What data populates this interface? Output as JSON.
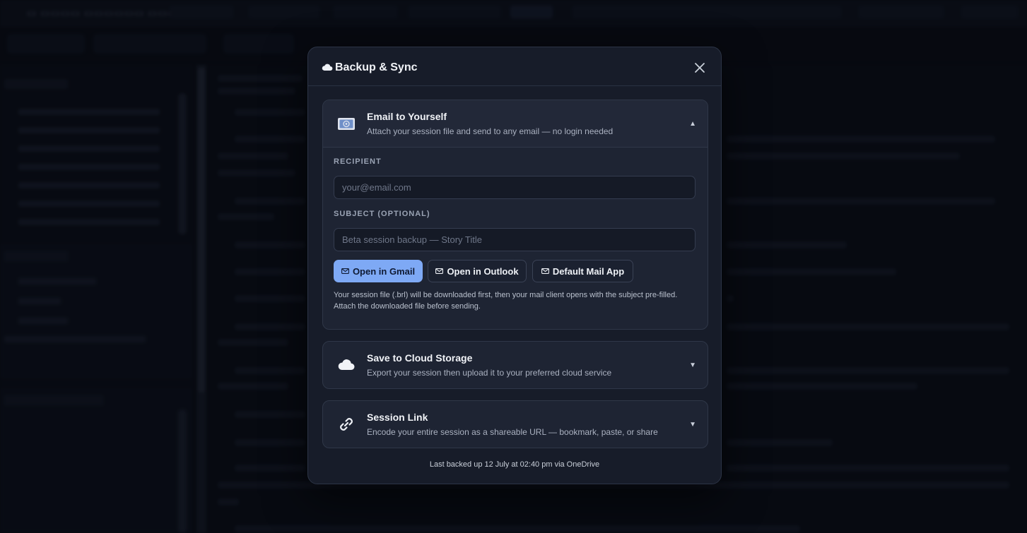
{
  "modal": {
    "title": "Backup & Sync",
    "close_icon": "close-icon",
    "email_section": {
      "title": "Email to Yourself",
      "subtitle": "Attach your session file and send to any email — no login needed",
      "recipient_label": "RECIPIENT",
      "recipient_placeholder": "your@email.com",
      "subject_label": "SUBJECT (OPTIONAL)",
      "subject_placeholder": "Beta session backup — Story Title",
      "buttons": {
        "gmail": "Open in Gmail",
        "outlook": "Open in Outlook",
        "default_mail": "Default Mail App"
      },
      "hint": "Your session file (.brl) will be downloaded first, then your mail client opens with the subject pre-filled. Attach the downloaded file before sending.",
      "expanded": true
    },
    "cloud_section": {
      "title": "Save to Cloud Storage",
      "subtitle": "Export your session then upload it to your preferred cloud service",
      "expanded": false
    },
    "link_section": {
      "title": "Session Link",
      "subtitle": "Encode your entire session as a shareable URL — bookmark, paste, or share",
      "expanded": false
    },
    "footer": "Last backed up 12 July at 02:40 pm via OneDrive"
  },
  "colors": {
    "accent": "#7ea9f5",
    "modal_bg": "#171c29",
    "card_bg": "#1e2433"
  }
}
